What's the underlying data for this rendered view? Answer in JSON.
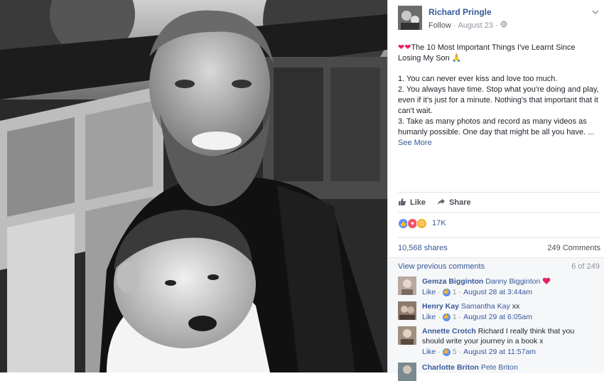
{
  "post": {
    "author": "Richard Pringle",
    "follow_label": "Follow",
    "separator": "·",
    "date": "August 23",
    "separator2": "·",
    "icons": {
      "privacy": "globe-icon",
      "menu": "chevron-down-icon"
    },
    "title_hearts": "❤❤",
    "title": "The 10 Most Important Things I've Learnt Since Losing My Son 🙏",
    "body": [
      "1. You can never ever kiss and love too much.",
      "2. You always have time. Stop what you're doing and play, even if it's just for a minute. Nothing's that important that it can't wait.",
      "3. Take as many photos and record as many videos as humanly possible. One day that might be all you have. ..."
    ],
    "see_more": "See More"
  },
  "actions": {
    "like_label": "Like",
    "share_label": "Share"
  },
  "reactions": {
    "count": "17K",
    "types": [
      "like",
      "love",
      "sad"
    ]
  },
  "stats": {
    "shares": "10,568 shares",
    "comments": "249 Comments"
  },
  "comments_section": {
    "view_previous": "View previous comments",
    "counter": "6 of 249",
    "items": [
      {
        "name": "Gemza Bigginton",
        "text": "Danny Bigginton",
        "tagged": true,
        "has_heart": true,
        "like": "Like",
        "likes": "1",
        "dot": "·",
        "time": "August 28 at 3:44am"
      },
      {
        "name": "Henry Kay",
        "text": "Samantha Kay",
        "tagged": true,
        "suffix": "xx",
        "like": "Like",
        "likes": "1",
        "dot": "·",
        "time": "August 29 at 6:05am"
      },
      {
        "name": "Annette Crotch",
        "text": "Richard I really think that you should write your journey in a book x",
        "tagged": false,
        "like": "Like",
        "likes": "5",
        "dot": "·",
        "time": "August 29 at 11:57am"
      },
      {
        "name": "Charlotte Briton",
        "text": "Pete Briton",
        "tagged": true
      }
    ]
  },
  "colors": {
    "link": "#365899",
    "meta": "#90949c",
    "text": "#1d2129",
    "comment_bg": "#f6f7f9"
  }
}
